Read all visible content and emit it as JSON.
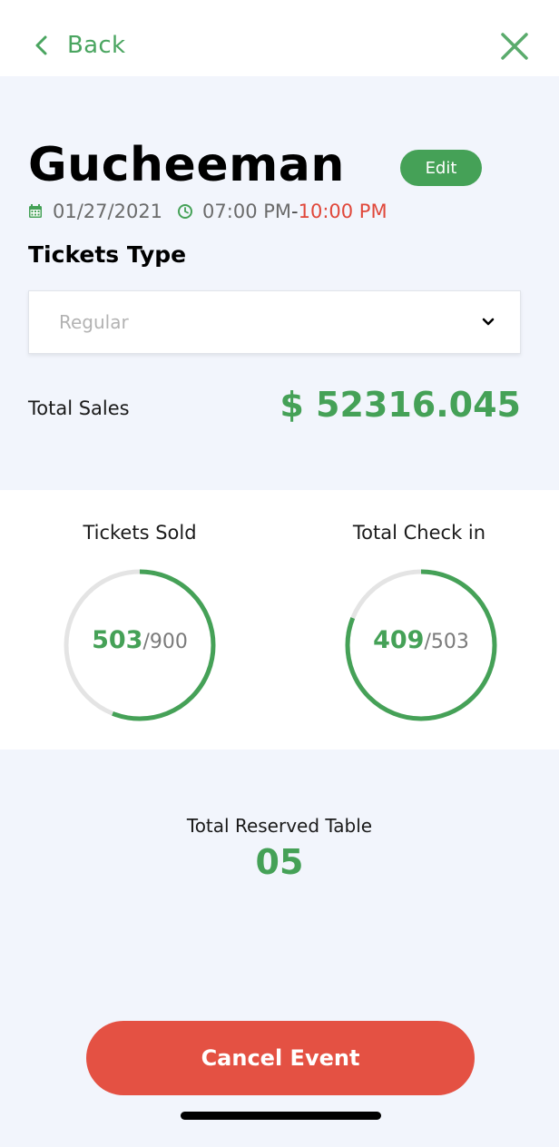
{
  "nav": {
    "back_label": "Back",
    "back_icon": "chevron-left-icon",
    "close_icon": "close-icon"
  },
  "event": {
    "title": "Gucheeman",
    "edit_label": "Edit",
    "date": "01/27/2021",
    "start_time": "07:00 PM",
    "time_separator": "-",
    "end_time": "10:00 PM"
  },
  "tickets_type": {
    "label": "Tickets Type",
    "selected": "Regular"
  },
  "total_sales": {
    "label": "Total Sales",
    "value": "$ 52316.045"
  },
  "stats": [
    {
      "label": "Tickets Sold",
      "value": "503",
      "slash": "/",
      "total": "900",
      "progress": 0.56
    },
    {
      "label": "Total Check in",
      "value": "409",
      "slash": "/",
      "total": "503",
      "progress": 0.81
    }
  ],
  "reserved": {
    "label": "Total Reserved Table",
    "value": "05"
  },
  "actions": {
    "cancel_label": "Cancel Event"
  },
  "colors": {
    "accent_green": "#45a157",
    "danger_red": "#e45143",
    "end_time_red": "#e0473a",
    "ring_track": "#e4e4e4",
    "background": "#f2f5fc"
  }
}
